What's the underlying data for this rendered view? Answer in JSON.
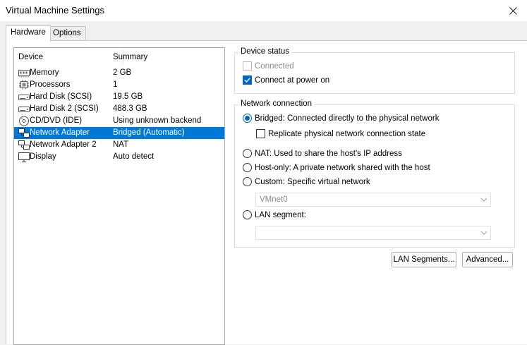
{
  "window": {
    "title": "Virtual Machine Settings"
  },
  "tabs": [
    {
      "label": "Hardware",
      "active": true
    },
    {
      "label": "Options",
      "active": false
    }
  ],
  "device_list": {
    "headers": {
      "device": "Device",
      "summary": "Summary"
    },
    "items": [
      {
        "icon": "memory-icon",
        "name": "Memory",
        "summary": "2 GB",
        "selected": false
      },
      {
        "icon": "processor-icon",
        "name": "Processors",
        "summary": "1",
        "selected": false
      },
      {
        "icon": "hard-disk-icon",
        "name": "Hard Disk (SCSI)",
        "summary": "19.5 GB",
        "selected": false
      },
      {
        "icon": "hard-disk-icon",
        "name": "Hard Disk 2 (SCSI)",
        "summary": "488.3 GB",
        "selected": false
      },
      {
        "icon": "cd-dvd-icon",
        "name": "CD/DVD (IDE)",
        "summary": "Using unknown backend",
        "selected": false
      },
      {
        "icon": "network-adapter-icon",
        "name": "Network Adapter",
        "summary": "Bridged (Automatic)",
        "selected": true
      },
      {
        "icon": "network-adapter-icon",
        "name": "Network Adapter 2",
        "summary": "NAT",
        "selected": false
      },
      {
        "icon": "display-icon",
        "name": "Display",
        "summary": "Auto detect",
        "selected": false
      }
    ]
  },
  "device_status": {
    "title": "Device status",
    "connected": {
      "label": "Connected",
      "checked": false,
      "enabled": false
    },
    "connect_at_power_on": {
      "label": "Connect at power on",
      "checked": true,
      "enabled": true
    }
  },
  "network_connection": {
    "title": "Network connection",
    "bridged": {
      "label": "Bridged: Connected directly to the physical network",
      "checked": true
    },
    "replicate": {
      "label": "Replicate physical network connection state",
      "checked": false
    },
    "nat": {
      "label": "NAT: Used to share the host's IP address",
      "checked": false
    },
    "host_only": {
      "label": "Host-only: A private network shared with the host",
      "checked": false
    },
    "custom": {
      "label": "Custom: Specific virtual network",
      "checked": false
    },
    "custom_select_value": "VMnet0",
    "lan_segment": {
      "label": "LAN segment:",
      "checked": false
    },
    "lan_segment_select_value": ""
  },
  "buttons": {
    "lan_segments": "LAN Segments...",
    "advanced": "Advanced..."
  },
  "colors": {
    "selection": "#0078d7",
    "accent": "#0067c0"
  }
}
